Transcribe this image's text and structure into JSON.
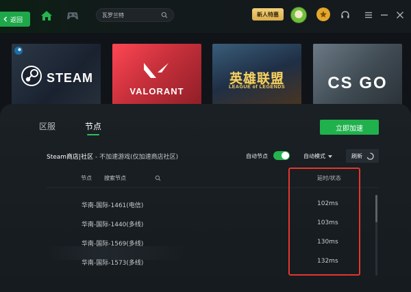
{
  "topbar": {
    "back_label": "返回",
    "search_placeholder": "瓦罗兰特",
    "newbie_label": "新人特惠"
  },
  "games": [
    {
      "name": "STEAM"
    },
    {
      "name": "VALORANT"
    },
    {
      "name": "英雄联盟",
      "subtitle": "LEAGUE of LEGENDS"
    },
    {
      "name": "CS GO"
    }
  ],
  "panel": {
    "tabs": [
      {
        "label": "区服",
        "active": false
      },
      {
        "label": "节点",
        "active": true
      }
    ],
    "accelerate_label": "立即加速",
    "game_title": "Steam商店|社区",
    "game_note": " - 不加速游戏(仅加速商店社区)",
    "auto_node_label": "自动节点",
    "auto_node_on": true,
    "mode_label": "自动模式",
    "refresh_label": "刷新",
    "columns": {
      "node": "节点",
      "search_placeholder": "搜索节点",
      "latency": "延时/状态"
    },
    "nodes": [
      {
        "name": "华南-国际-1461(电信)",
        "latency": "102ms"
      },
      {
        "name": "华南-国际-1440(多线)",
        "latency": "103ms"
      },
      {
        "name": "华南-国际-1569(多线)",
        "latency": "130ms"
      },
      {
        "name": "华南-国际-1573(多线)",
        "latency": "132ms"
      }
    ]
  },
  "colors": {
    "accent_green": "#20b14d",
    "highlight_red": "#e5372c",
    "gold": "#e3a72b"
  }
}
